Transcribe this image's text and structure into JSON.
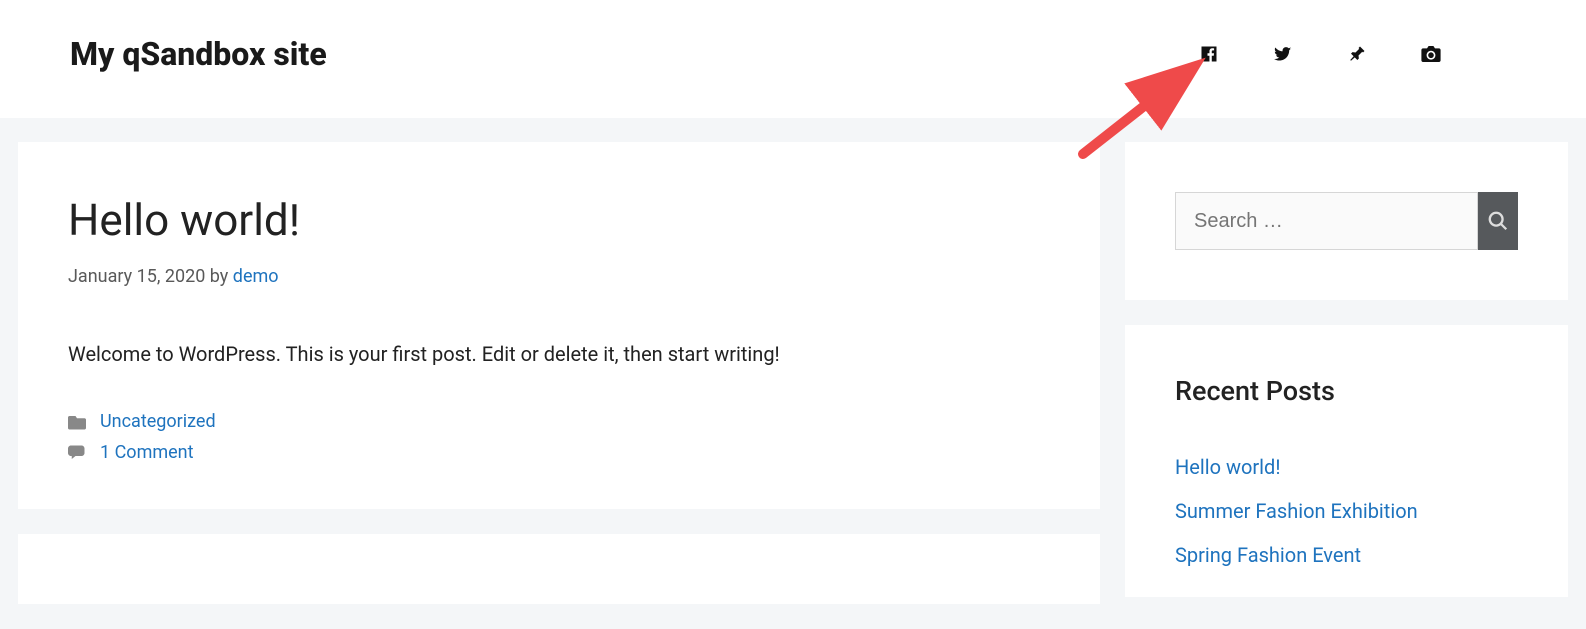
{
  "header": {
    "site_title": "My qSandbox site",
    "social": {
      "facebook": "facebook",
      "twitter": "twitter",
      "pinterest": "pinterest",
      "instagram": "instagram"
    }
  },
  "post": {
    "title": "Hello world!",
    "date": "January 15, 2020",
    "by_label": "by",
    "author": "demo",
    "content": "Welcome to WordPress. This is your first post. Edit or delete it, then start writing!",
    "category": "Uncategorized",
    "comments": "1 Comment"
  },
  "post2": {
    "title_partial": ""
  },
  "sidebar": {
    "search": {
      "placeholder": "Search …"
    },
    "recent": {
      "title": "Recent Posts",
      "items": [
        "Hello world!",
        "Summer Fashion Exhibition",
        "Spring Fashion Event"
      ]
    }
  }
}
